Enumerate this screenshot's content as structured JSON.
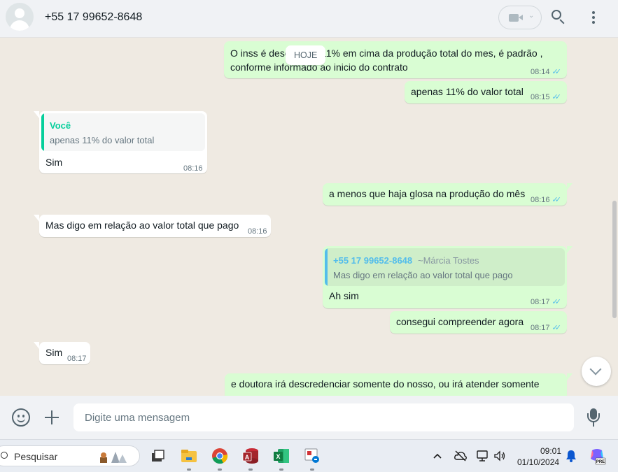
{
  "header": {
    "contact_name": "+55 17 99652-8648",
    "icons": [
      "avatar",
      "video-call-icon",
      "chevron-down-icon",
      "search-icon",
      "menu-icon"
    ]
  },
  "chat": {
    "day_chip": "HOJE",
    "messages": [
      {
        "direction": "out",
        "lines": [
          "O inss é desc",
          "11% em cima da produção total do mes, é padrão ,",
          "conforme informado ao inicio do contrato"
        ],
        "time": "08:14",
        "ticks": "✓✓"
      },
      {
        "direction": "out",
        "text": "apenas 11% do valor total",
        "time": "08:15",
        "ticks": "✓✓"
      },
      {
        "direction": "in",
        "quote_author": "Você",
        "quote_text": "apenas 11% do valor total",
        "text": "Sim",
        "time": "08:16"
      },
      {
        "direction": "out",
        "text": "a menos que haja glosa na produção do mês",
        "time": "08:16",
        "ticks": "✓✓"
      },
      {
        "direction": "in",
        "text": "Mas digo em relação ao valor total que pago",
        "time": "08:16"
      },
      {
        "direction": "out",
        "quote_author": "+55 17 99652-8648",
        "quote_alias": "~Márcia Tostes",
        "quote_text": "Mas digo em relação ao valor total que pago",
        "text": "Ah sim",
        "time": "08:17",
        "ticks": "✓✓"
      },
      {
        "direction": "out",
        "text": "consegui compreender agora",
        "time": "08:17",
        "ticks": "✓✓"
      },
      {
        "direction": "in",
        "text": "Sim",
        "time": "08:17"
      },
      {
        "direction": "out",
        "text": "e doutora irá descredenciar somente do nosso, ou irá atender somente"
      }
    ]
  },
  "composer": {
    "placeholder": "Digite uma mensagem"
  },
  "taskbar": {
    "search_label": "Pesquisar",
    "time": "09:01",
    "date": "01/10/2024",
    "copilot_badge": "PRE"
  },
  "colors": {
    "outgoing_bubble": "#d9fdd3",
    "incoming_bubble": "#ffffff",
    "chat_background": "#efeae2",
    "read_ticks": "#53bdeb",
    "quote_you": "#06cf9c",
    "quote_contact": "#53bdeb"
  }
}
